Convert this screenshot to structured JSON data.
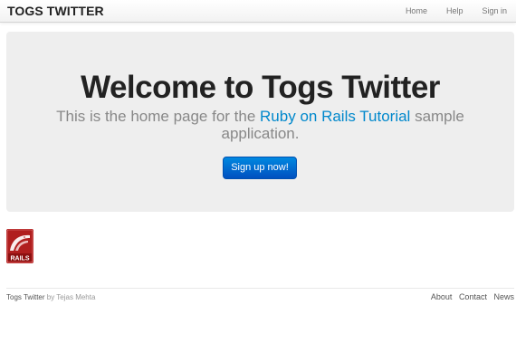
{
  "header": {
    "brand": "TOGS TWITTER",
    "nav": [
      {
        "label": "Home"
      },
      {
        "label": "Help"
      },
      {
        "label": "Sign in"
      }
    ]
  },
  "hero": {
    "title": "Welcome to Togs Twitter",
    "lead_before": "This is the home page for the ",
    "lead_link": "Ruby on Rails Tutorial",
    "lead_after": " sample application.",
    "signup_button": "Sign up now!"
  },
  "logo": {
    "text": "RAILS",
    "icon": "rails-logo"
  },
  "footer": {
    "site": "Togs Twitter",
    "by": " by Tejas Mehta",
    "links": [
      {
        "label": "About"
      },
      {
        "label": "Contact"
      },
      {
        "label": "News"
      }
    ]
  },
  "colors": {
    "link": "#0088cc",
    "button": "#0066d0",
    "hero_bg": "#eeeeee",
    "logo_red": "#b01e1e"
  }
}
